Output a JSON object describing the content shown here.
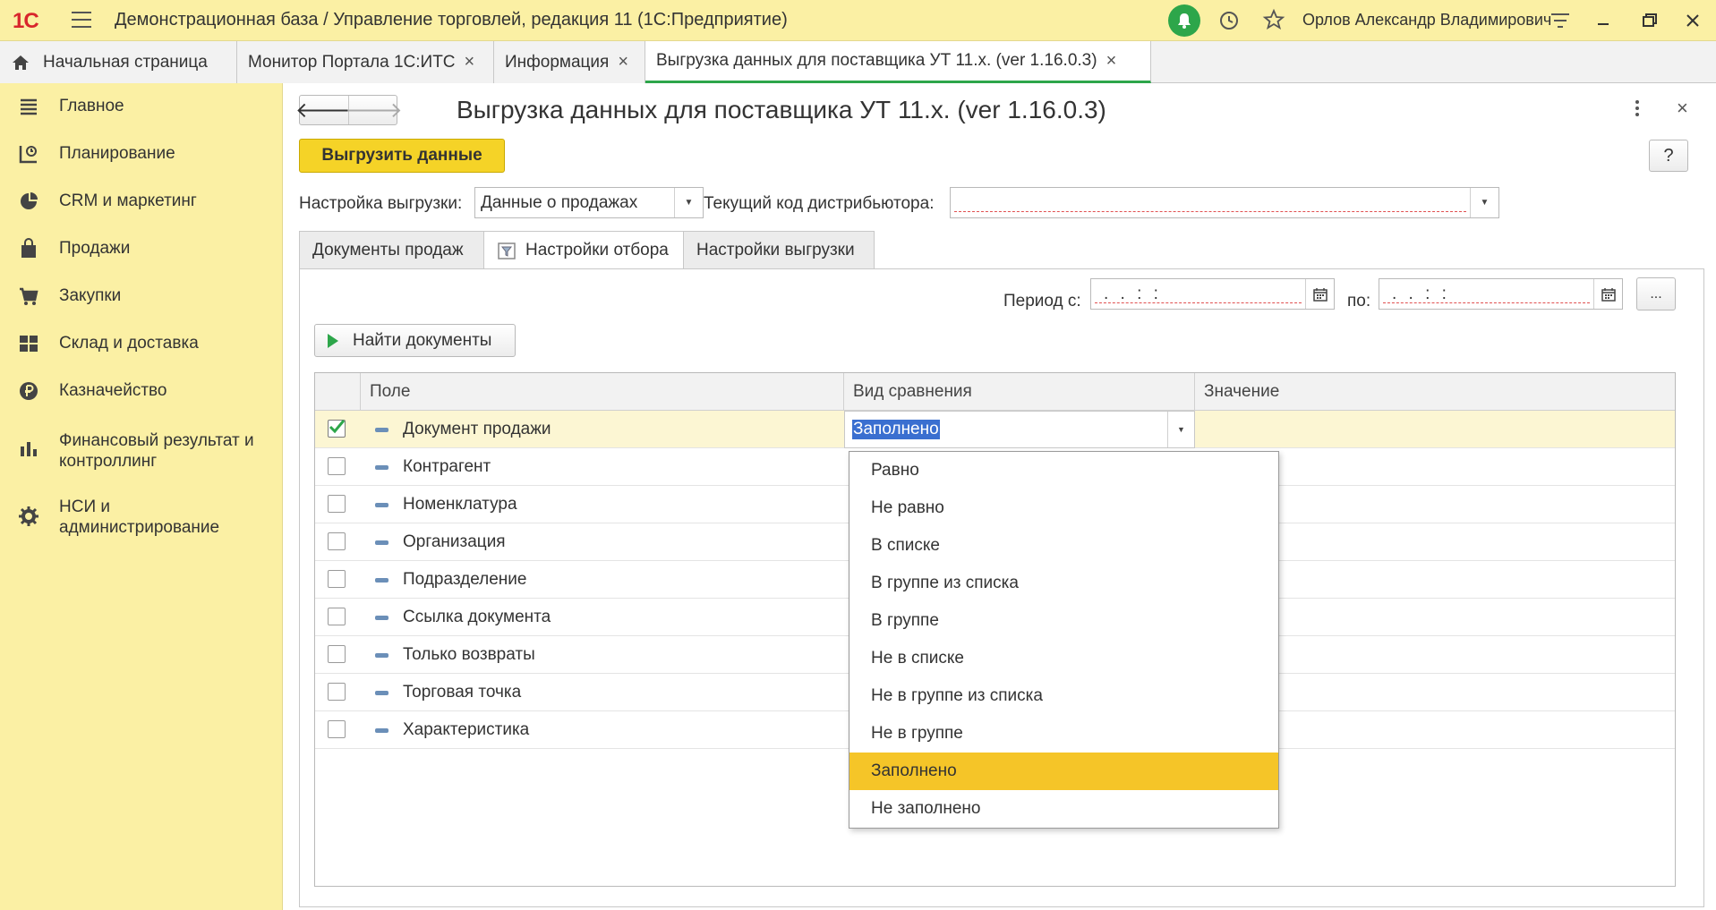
{
  "app": {
    "logo": "1С",
    "title": "Демонстрационная база / Управление торговлей, редакция 11  (1С:Предприятие)",
    "user": "Орлов Александр Владимирович"
  },
  "tabs": [
    {
      "label": "Начальная страница"
    },
    {
      "label": "Монитор Портала 1С:ИТС"
    },
    {
      "label": "Информация"
    },
    {
      "label": "Выгрузка данных для поставщика УТ 11.x. (ver 1.16.0.3)"
    }
  ],
  "sidebar": {
    "items": [
      {
        "label": "Главное"
      },
      {
        "label": "Планирование"
      },
      {
        "label": "CRM и маркетинг"
      },
      {
        "label": "Продажи"
      },
      {
        "label": "Закупки"
      },
      {
        "label": "Склад и доставка"
      },
      {
        "label": "Казначейство"
      },
      {
        "label": "Финансовый результат и контроллинг"
      },
      {
        "label": "НСИ и администрирование"
      }
    ]
  },
  "form": {
    "title": "Выгрузка данных для поставщика УТ 11.x. (ver 1.16.0.3)",
    "export_button": "Выгрузить данные",
    "help_button": "?",
    "settings_label": "Настройка выгрузки:",
    "settings_value": "Данные о продажах",
    "distributor_label": "Текущий код дистрибьютора:",
    "distributor_value": "",
    "form_tabs": [
      {
        "label": "Документы продаж"
      },
      {
        "label": "Настройки отбора"
      },
      {
        "label": "Настройки выгрузки"
      }
    ],
    "period_from_label": "Период с:",
    "period_from_value": " .  .    :  :",
    "period_to_label": "по:",
    "period_to_value": " .  .    :  :",
    "dots_button": "...",
    "find_button": "Найти документы"
  },
  "grid": {
    "columns": [
      "Поле",
      "Вид сравнения",
      "Значение"
    ],
    "rows": [
      {
        "field": "Документ продажи",
        "checked": true,
        "comparison": "Заполнено"
      },
      {
        "field": "Контрагент",
        "checked": false
      },
      {
        "field": "Номенклатура",
        "checked": false
      },
      {
        "field": "Организация",
        "checked": false
      },
      {
        "field": "Подразделение",
        "checked": false
      },
      {
        "field": "Ссылка документа",
        "checked": false
      },
      {
        "field": "Только возвраты",
        "checked": false
      },
      {
        "field": "Торговая точка",
        "checked": false
      },
      {
        "field": "Характеристика",
        "checked": false
      }
    ]
  },
  "dropdown": {
    "options": [
      "Равно",
      "Не равно",
      "В списке",
      "В группе из списка",
      "В группе",
      "Не в списке",
      "Не в группе из списка",
      "Не в группе",
      "Заполнено",
      "Не заполнено"
    ],
    "selected": "Заполнено"
  },
  "colors": {
    "sidebar_bg": "#fbf0a4",
    "accent_yellow": "#f5d327",
    "highlight": "#f5c528",
    "green": "#2da64a"
  }
}
